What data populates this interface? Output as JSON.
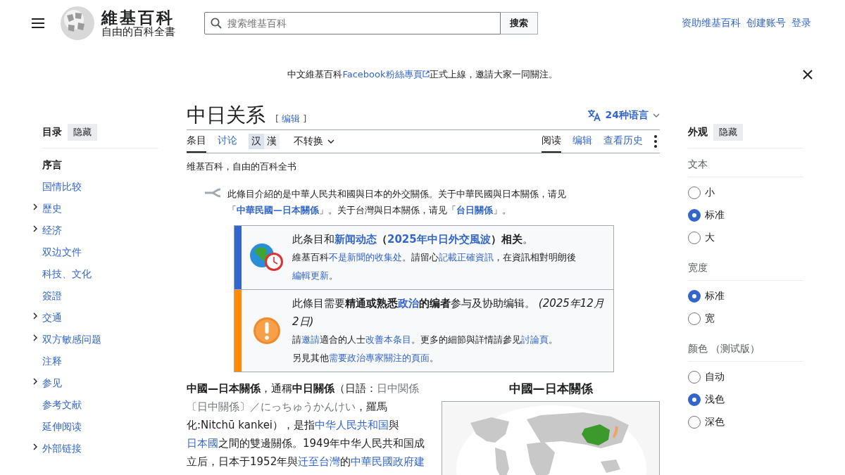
{
  "header": {
    "logo_title": "維基百科",
    "logo_subtitle": "自由的百科全書",
    "search": {
      "placeholder": "搜索维基百科",
      "button": "搜索"
    },
    "user_links": [
      "资助维基百科",
      "创建账号",
      "登录"
    ]
  },
  "banner": {
    "segments": [
      {
        "text": "中文維基百科"
      },
      {
        "text": "Facebook粉絲專頁",
        "link": true,
        "external": true
      },
      {
        "text": "正式上線，邀請大家一同關注。"
      }
    ]
  },
  "toc": {
    "title": "目录",
    "hide": "隐藏",
    "items": [
      {
        "label": "序言",
        "selected": true,
        "expandable": false
      },
      {
        "label": "国情比较",
        "selected": false,
        "expandable": false
      },
      {
        "label": "歷史",
        "selected": false,
        "expandable": true
      },
      {
        "label": "经济",
        "selected": false,
        "expandable": true
      },
      {
        "label": "双边文件",
        "selected": false,
        "expandable": false
      },
      {
        "label": "科技、文化",
        "selected": false,
        "expandable": false
      },
      {
        "label": "簽證",
        "selected": false,
        "expandable": false
      },
      {
        "label": "交通",
        "selected": false,
        "expandable": true
      },
      {
        "label": "双方敏感问题",
        "selected": false,
        "expandable": true
      },
      {
        "label": "注释",
        "selected": false,
        "expandable": false
      },
      {
        "label": "参见",
        "selected": false,
        "expandable": true
      },
      {
        "label": "参考文献",
        "selected": false,
        "expandable": false
      },
      {
        "label": "延伸阅读",
        "selected": false,
        "expandable": false
      },
      {
        "label": "外部链接",
        "selected": false,
        "expandable": true
      }
    ]
  },
  "article": {
    "title": "中日关系",
    "edit_open": "[",
    "edit": "编辑",
    "edit_close": "]",
    "languages": "24种语言",
    "tabs_left": [
      {
        "label": "条目",
        "selected": true
      },
      {
        "label": "讨论",
        "selected": false
      }
    ],
    "variants": [
      {
        "label": "汉",
        "selected": true
      },
      {
        "label": "漢",
        "selected": false
      }
    ],
    "variant_menu": "不转换",
    "tabs_right": [
      {
        "label": "阅读",
        "selected": true
      },
      {
        "label": "编辑",
        "selected": false
      },
      {
        "label": "查看历史",
        "selected": false
      }
    ],
    "tagline": "维基百科，自由的百科全书",
    "hatnote": [
      {
        "text": "此條目介紹的是中華人民共和國與日本的外交關係。关于中華民國與日本關係，请见「"
      },
      {
        "text": "中華民國—日本關係",
        "link": true,
        "bold": true
      },
      {
        "text": "」。关于台灣與日本關係，请见「"
      },
      {
        "text": "台日關係",
        "link": true,
        "bold": true
      },
      {
        "text": "」。"
      }
    ],
    "notices": [
      {
        "kind": "news",
        "color": "#3366cc",
        "lines": [
          [
            {
              "text": "此条目和"
            },
            {
              "text": "新闻动态",
              "link": true,
              "bold": true
            },
            {
              "text": "（",
              "bold": true
            },
            {
              "text": "2025年中日外交風波",
              "link": true,
              "bold": true
            },
            {
              "text": "）相关",
              "bold": true
            },
            {
              "text": "。"
            }
          ],
          [
            {
              "text": "維基百科"
            },
            {
              "text": "不是新聞的收集处",
              "link": true
            },
            {
              "text": "。請留心"
            },
            {
              "text": "記載正確資訊",
              "link": true
            },
            {
              "text": "，在資訊相對明朗後"
            },
            {
              "text": "編輯更新",
              "link": true
            },
            {
              "text": "。"
            }
          ]
        ]
      },
      {
        "kind": "expert",
        "color": "#ff8c00",
        "lines": [
          [
            {
              "text": "此條目需要"
            },
            {
              "text": "精通或熟悉",
              "bold": true
            },
            {
              "text": "政治",
              "link": true,
              "bold": true
            },
            {
              "text": "的编者",
              "bold": true
            },
            {
              "text": "参与及协助编辑。 "
            },
            {
              "text": "(2025年12月2日)",
              "italic": true
            }
          ],
          [
            {
              "text": "請"
            },
            {
              "text": "邀請",
              "link": true
            },
            {
              "text": "適合的人士"
            },
            {
              "text": "改善本条目",
              "link": true
            },
            {
              "text": "。更多的細節與詳情請參见"
            },
            {
              "text": "討論頁",
              "link": true
            },
            {
              "text": "。"
            }
          ],
          [
            {
              "text": "另見其他"
            },
            {
              "text": "需要政治專家關注的頁面",
              "link": true
            },
            {
              "text": "。"
            }
          ]
        ]
      }
    ],
    "lead": [
      {
        "text": "中國—日本關係",
        "bold": true
      },
      {
        "text": "，通稱"
      },
      {
        "text": "中日關係",
        "bold": true
      },
      {
        "text": "（日語："
      },
      {
        "text": "日中関係〔日中關係〕／にっちゅうかんけい",
        "muted": true
      },
      {
        "text": "，羅馬化:Nitchū kankei），是指"
      },
      {
        "text": "中华人民共和国",
        "link": true
      },
      {
        "text": "與"
      },
      {
        "text": "日本國",
        "link": true
      },
      {
        "text": "之間的雙邊關係。1949年中华人民共和国成立后，日本于1952年與"
      },
      {
        "text": "迁至台灣",
        "link": true
      },
      {
        "text": "的"
      },
      {
        "text": "中華民國政府建",
        "link": true
      }
    ],
    "infobox": {
      "title": "中國—日本關係"
    }
  },
  "appearance": {
    "title": "外观",
    "hide": "隐藏",
    "groups": [
      {
        "label": "文本",
        "options": [
          {
            "label": "小",
            "selected": false
          },
          {
            "label": "标准",
            "selected": true
          },
          {
            "label": "大",
            "selected": false
          }
        ]
      },
      {
        "label": "宽度",
        "options": [
          {
            "label": "标准",
            "selected": true
          },
          {
            "label": "宽",
            "selected": false
          }
        ]
      },
      {
        "label": "颜色 （测试版）",
        "options": [
          {
            "label": "自动",
            "selected": false
          },
          {
            "label": "浅色",
            "selected": true
          },
          {
            "label": "深色",
            "selected": false
          }
        ]
      }
    ]
  }
}
